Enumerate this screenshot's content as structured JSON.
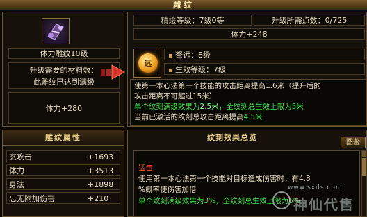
{
  "window": {
    "title": "雕纹"
  },
  "left": {
    "level_text": "体力雕纹10级",
    "materials_label": "升级需要的材料数：",
    "materials_value": "此雕纹已达到满级",
    "stat": "体力+280"
  },
  "right": {
    "refine_level": "精绘等级：7级0等",
    "points_needed": "升级所需点数：0/725",
    "stat": "体力+248",
    "gem_icon_glyph": "远",
    "gem_name": "弩远：8级",
    "gem_effect_level": "生效等级：7级",
    "desc": {
      "line1": "使第一本心法第一个技能的攻击距离提高1.6米（提升后的",
      "line2": "攻击距离不可超过15米）",
      "line3_pre": "单个纹刻满级效果为",
      "line3_hl": "2.5米",
      "line3_post": "，全纹刻总生效上限为5米",
      "line4_pre": "当前已激活的纹刻总攻击距离提高",
      "line4_val": "4.5米"
    }
  },
  "attributes": {
    "title": "雕纹属性",
    "rows": [
      {
        "name": "玄攻击",
        "value": "+1693"
      },
      {
        "name": "体力",
        "value": "+3513"
      },
      {
        "name": "身法",
        "value": "+1898"
      },
      {
        "name": "忘无附加伤害",
        "value": "+210"
      }
    ]
  },
  "effects": {
    "title": "纹刻效果总览",
    "atlas_button": "图鉴",
    "name": "猛击",
    "line1": "使用第一本心法第一个技能对目标造成伤害时，有4.8",
    "line2": "%概率使伤害加倍",
    "line3": "单个纹刻满级效果为3%，全纹刻总生效上限为6%"
  },
  "watermark": {
    "site": "www.sxds.com",
    "text": "神仙代售"
  },
  "colors": {
    "accent_gold": "#b08a48",
    "effect_green": "#42e04a",
    "effect_name_red": "#ff5a2a"
  }
}
